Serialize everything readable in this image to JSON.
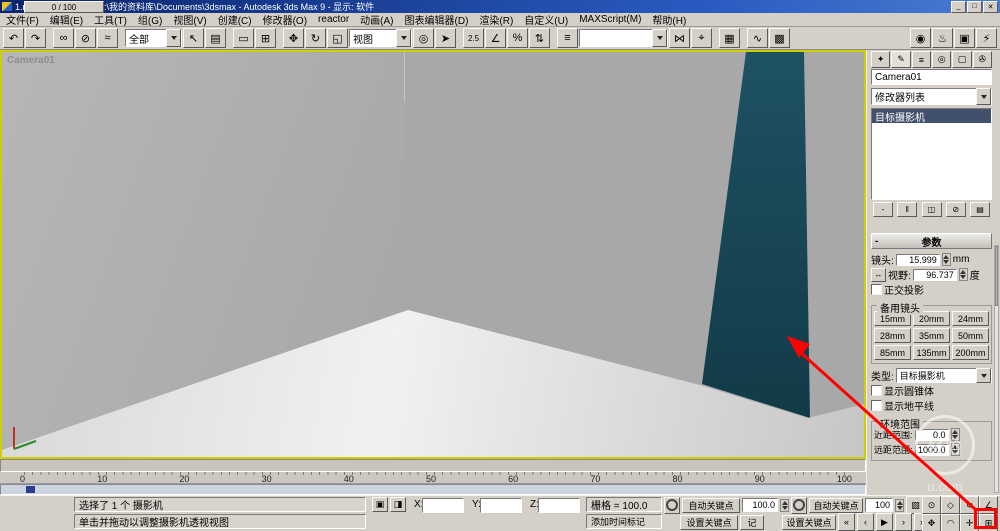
{
  "window": {
    "title": "1.max - 项目文件夹: D:\\我的资料库\\Documents\\3dsmax  - Autodesk 3ds Max 9  - 显示: 软件",
    "minimize": "_",
    "maximize": "□",
    "close": "✕"
  },
  "menu": {
    "items": [
      "文件(F)",
      "编辑(E)",
      "工具(T)",
      "组(G)",
      "视图(V)",
      "创建(C)",
      "修改器(O)",
      "reactor",
      "动画(A)",
      "图表编辑器(D)",
      "渲染(R)",
      "自定义(U)",
      "MAXScript(M)",
      "帮助(H)"
    ]
  },
  "toolbar": {
    "filter_dropdown": "全部",
    "coord_dropdown": "视图",
    "named_sets_value": "",
    "icons": [
      {
        "name": "undo-icon",
        "glyph": "↶"
      },
      {
        "name": "redo-icon",
        "glyph": "↷"
      },
      {
        "name": "select-and-link-icon",
        "glyph": "∞"
      },
      {
        "name": "unlink-selection-icon",
        "glyph": "⊘"
      },
      {
        "name": "bind-to-space-warp-icon",
        "glyph": "≈"
      },
      {
        "name": "select-object-icon",
        "glyph": "↖"
      },
      {
        "name": "select-by-name-icon",
        "glyph": "▤"
      },
      {
        "name": "rectangular-selection-region-icon",
        "glyph": "▭"
      },
      {
        "name": "window-crossing-toggle-icon",
        "glyph": "⊞"
      },
      {
        "name": "select-and-move-icon",
        "glyph": "✥"
      },
      {
        "name": "select-and-rotate-icon",
        "glyph": "↻"
      },
      {
        "name": "select-and-scale-icon",
        "glyph": "◱"
      },
      {
        "name": "use-pivot-center-icon",
        "glyph": "◎"
      },
      {
        "name": "select-and-manipulate-icon",
        "glyph": "➤"
      },
      {
        "name": "snap-toggle-icon",
        "glyph": "2.5"
      },
      {
        "name": "angle-snap-icon",
        "glyph": "∠"
      },
      {
        "name": "percent-snap-icon",
        "glyph": "%"
      },
      {
        "name": "spinner-snap-icon",
        "glyph": "⇅"
      },
      {
        "name": "edit-named-selections-icon",
        "glyph": "≡"
      },
      {
        "name": "mirror-icon",
        "glyph": "⋈"
      },
      {
        "name": "align-icon",
        "glyph": "⌖"
      },
      {
        "name": "layer-manager-icon",
        "glyph": "▦"
      },
      {
        "name": "curve-editor-icon",
        "glyph": "∿"
      },
      {
        "name": "schematic-view-icon",
        "glyph": "▩"
      },
      {
        "name": "material-editor-icon",
        "glyph": "◉"
      },
      {
        "name": "render-scene-icon",
        "glyph": "♨"
      },
      {
        "name": "render-type-icon",
        "glyph": "▣"
      },
      {
        "name": "quick-render-icon",
        "glyph": "⚡"
      }
    ]
  },
  "viewport": {
    "label": "Camera01"
  },
  "panel": {
    "tabs": [
      {
        "name": "create-tab",
        "glyph": "✦"
      },
      {
        "name": "modify-tab",
        "glyph": "✎"
      },
      {
        "name": "hierarchy-tab",
        "glyph": "≡"
      },
      {
        "name": "motion-tab",
        "glyph": "◎"
      },
      {
        "name": "display-tab",
        "glyph": "▢"
      },
      {
        "name": "utilities-tab",
        "glyph": "✇"
      }
    ],
    "object_name": "Camera01",
    "modifier_list": "修改器列表",
    "stack_selected": "目标摄影机",
    "stack_buttons": [
      {
        "name": "pin-stack-button",
        "glyph": "-"
      },
      {
        "name": "show-end-result-button",
        "glyph": "‖"
      },
      {
        "name": "make-unique-button",
        "glyph": "◫"
      },
      {
        "name": "remove-modifier-button",
        "glyph": "⊘"
      },
      {
        "name": "configure-modifier-sets-button",
        "glyph": "▤"
      }
    ],
    "collapse_icon": "-",
    "params_rollout": "参数",
    "lens_label": "镜头:",
    "lens_value": "15.999",
    "lens_unit": "mm",
    "fov_dir": "↔",
    "fov_label": "视野:",
    "fov_value": "96.737",
    "fov_unit": "度",
    "ortho_label": "正交投影",
    "stock_group": "备用镜头",
    "stock_lenses": [
      "15mm",
      "20mm",
      "24mm",
      "28mm",
      "35mm",
      "50mm",
      "85mm",
      "135mm",
      "200mm"
    ],
    "type_label": "类型:",
    "type_value": "目标摄影机",
    "show_cone": "显示圆锥体",
    "show_horizon": "显示地平线",
    "env_group": "环境范围",
    "near_label": "近距范围:",
    "near_value": "0.0",
    "far_label": "远距范围:",
    "far_value": "1000.0"
  },
  "timeline": {
    "slider_label": "0 / 100",
    "ticks": [
      "0",
      "10",
      "20",
      "30",
      "40",
      "50",
      "60",
      "70",
      "80",
      "90",
      "100"
    ]
  },
  "status": {
    "selection": "选择了 1 个 摄影机",
    "prompt": "单击并拖动以调整摄影机透视视图",
    "lock_icon": "▣",
    "coord_mode_icon": "◨",
    "x": "X:",
    "y": "Y:",
    "z": "Z:",
    "grid": "栅格 = 100.0",
    "add_time_tag": "添加时间标记"
  },
  "anim": {
    "auto_key": "自动关键点",
    "set_key": "设置关键点",
    "key_filter": "记",
    "frame_value_1": "100.0",
    "frame_value_2": "100",
    "extra": [
      {
        "name": "time-configuration-button",
        "glyph": "▧"
      },
      {
        "name": "key-mode-toggle-button",
        "glyph": "◈"
      }
    ],
    "playback": [
      {
        "name": "go-to-start-button",
        "glyph": "«"
      },
      {
        "name": "previous-frame-button",
        "glyph": "‹"
      },
      {
        "name": "play-button",
        "glyph": "▶"
      },
      {
        "name": "next-frame-button",
        "glyph": "›"
      },
      {
        "name": "go-to-end-button",
        "glyph": "»"
      }
    ],
    "nav": [
      {
        "name": "dolly-camera-button",
        "glyph": "⊙"
      },
      {
        "name": "perspective-button",
        "glyph": "◇"
      },
      {
        "name": "roll-camera-button",
        "glyph": "↻"
      },
      {
        "name": "fov-button",
        "glyph": "∠"
      },
      {
        "name": "truck-camera-button",
        "glyph": "✥"
      },
      {
        "name": "orbit-camera-button",
        "glyph": "◠"
      },
      {
        "name": "pan-viewport-button",
        "glyph": "✛"
      },
      {
        "name": "maximize-viewport-toggle-button",
        "glyph": "⊞"
      }
    ]
  },
  "watermark": {
    "brand": "经验",
    "domain": "u.com"
  },
  "colors": {
    "accent_red": "#ff0000",
    "viewport_border": "#d4d400",
    "teal_wall": "#1a4a5a",
    "title_blue": "#0a246a"
  }
}
